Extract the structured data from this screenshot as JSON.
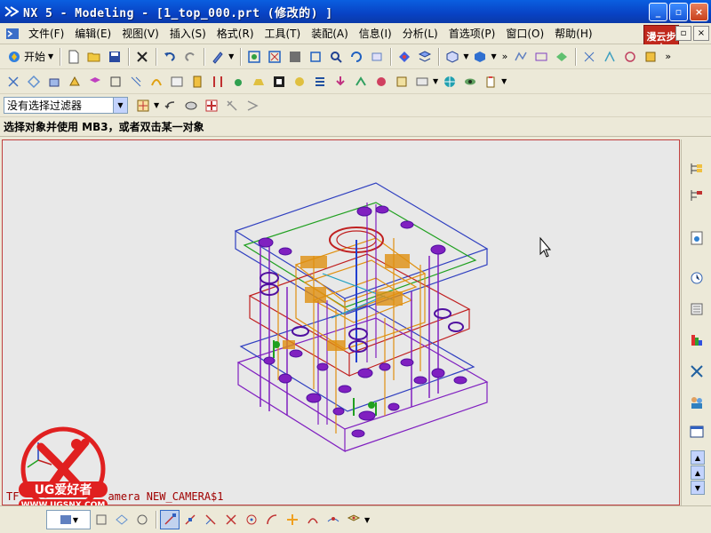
{
  "window": {
    "title": "NX 5 - Modeling - [1_top_000.prt  (修改的) ]",
    "buttons": [
      "_",
      "▫",
      "×"
    ]
  },
  "menu": {
    "items": [
      "文件(F)",
      "编辑(E)",
      "视图(V)",
      "插入(S)",
      "格式(R)",
      "工具(T)",
      "装配(A)",
      "信息(I)",
      "分析(L)",
      "首选项(P)",
      "窗口(O)",
      "帮助(H)"
    ]
  },
  "stamp": {
    "text": "漫云步杰"
  },
  "toolbar": {
    "start_label": "开始",
    "filter_value": "没有选择过滤器"
  },
  "cue_line": "选择对象并使用 MB3，或者双击某一对象",
  "viewport": {
    "view_label": "TF",
    "camera_label": "amera NEW_CAMERA$1"
  },
  "watermark": {
    "brand": "UG爱好者",
    "url": "WWW.UGSNX.COM"
  },
  "colors": {
    "titlebar": "#0a5fe0",
    "viewport_bg": "#e8e8e8",
    "viewport_border": "#c04040",
    "mold_blue": "#3040c0",
    "mold_purple": "#8020c0",
    "mold_orange": "#e09010",
    "mold_green": "#20a020",
    "mold_red": "#c02020",
    "watermark_red": "#e02020"
  }
}
